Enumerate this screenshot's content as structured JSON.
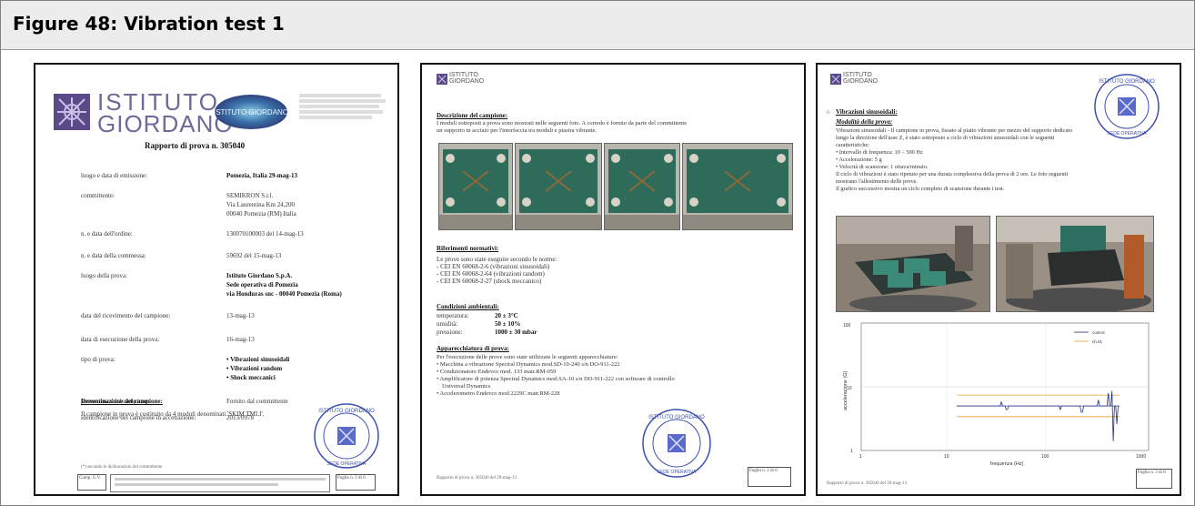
{
  "header": {
    "title": "Figure 48: Vibration test 1"
  },
  "page1": {
    "logo_line1": "ISTITUTO",
    "logo_line2": "GIORDANO",
    "badge_text": "ISTITUTO GIORDANO",
    "report_title": "Rapporto di prova n.  305040",
    "rows": [
      {
        "label": "luogo e data di emissione:",
        "value": "Pomezia, Italia   29-mag-13"
      },
      {
        "label": "committente:",
        "value": "SEMIKRON S.r.l."
      },
      {
        "label": "",
        "value": "Via Laurentina Km 24,200"
      },
      {
        "label": "",
        "value": "00040 Pomezia (RM) Italia"
      },
      {
        "label": "n. e data dell'ordine:",
        "value": "130070100003 del 14-mag-13"
      },
      {
        "label": "n. e data della commessa:",
        "value": "59692 del 15-mag-13"
      },
      {
        "label": "luogo della prova:",
        "value": "Istituto Giordano S.p.A."
      },
      {
        "label": "",
        "value": "Sede operativa di Pomezia"
      },
      {
        "label": "",
        "value": "via Honduras snc - 00040 Pomezia (Roma)"
      },
      {
        "label": "data del ricevimento del campione:",
        "value": "13-mag-13"
      },
      {
        "label": "data di esecuzione della prova:",
        "value": "16-mag-13"
      },
      {
        "label": "tipo di prova:",
        "value": "• Vibrazioni sinusoidali"
      },
      {
        "label": "",
        "value": "• Vibrazioni random"
      },
      {
        "label": "",
        "value": "• Shock meccanici"
      },
      {
        "label": "provenienza del campione:",
        "value": "Fornito dal committente"
      },
      {
        "label": "identificazione del campione in accettazione:",
        "value": "2013/0978"
      }
    ],
    "denom_heading": "Denominazione del campione:",
    "denom_text": "Il campione in prova è costituito da 4 moduli denominati 'SKIM TMLI'.",
    "footnote": "(*) secondo le dichiarazioni del committente",
    "box_left": "Comp. G.V.",
    "box_right": "Foglio n. 1 di 6"
  },
  "page2": {
    "logo_line1": "ISTITUTO",
    "logo_line2": "GIORDANO",
    "h1": "Descrizione del campione:",
    "p1a": "I moduli sottoposti a prova sono mostrati nelle seguenti foto. A corredo è fornito da parte del committente",
    "p1b": "un supporto in acciaio per l'interfaccia tra moduli e piastra vibrante.",
    "h2": "Riferimenti normativi:",
    "n0": "Le prove sono state eseguite secondo le norme:",
    "n1": "- CEI EN 60068-2-6 (vibrazioni sinusoidali)",
    "n2": "- CEI EN 60068-2-64 (vibrazioni random)",
    "n3": "- CEI EN 60068-2-27 (shock meccanico)",
    "h3": "Condizioni ambientali:",
    "c1l": "temperatura:",
    "c1v": "20 ± 3°C",
    "c2l": "umidità:",
    "c2v": "50 ± 10%",
    "c3l": "pressione:",
    "c3v": "1000 ± 30 mbar",
    "h4": "Apparecchiatura di prova:",
    "a0": "Per l'esecuzione delle prove sono state utilizzate le seguenti apparecchiature:",
    "a1": "• Macchina a vibrazione Spectral Dynamics mod.SD-10-240 s/n DO-911-222",
    "a2": "• Condizionatore Endevco mod. 133 matr.RM-059",
    "a3": "• Amplificatore di potenza Spectral Dynamics mod.SA-10 s/n DO-911-222 con software di controllo",
    "a3b": "Universal Dynamics",
    "a4": "• Accelerometro Endevco mod.2229C matr.RM-228",
    "footer": "Rapporto di prova n. 305040  del  29-mag-13",
    "box": "Foglio n. 2 di 6"
  },
  "page3": {
    "logo_line1": "ISTITUTO",
    "logo_line2": "GIORDANO",
    "h1": "Vibrazioni sinusoidali:",
    "h2": "Modalità della prova:",
    "l1": "Vibrazioni sinusoidali - Il campione in prova, fissato al piatto vibrante per mezzo del supporto dedicato",
    "l2": "lungo la direzione dell'asse Z, è stato sottoposto a ciclo di vibrazioni sinusoidali con le seguenti",
    "l3": "caratteristiche:",
    "b1": "• Intervallo di frequenza: 10 ÷ 500 Hz",
    "b2": "• Accelerazione: 5 g",
    "b3": "• Velocità di scansione: 1 ottava/minuto.",
    "l4": "Il ciclo di vibrazioni è stato ripetuto per una durata complessiva della prova di 2 ore. Le foto seguenti",
    "l5": "mostrano l'allestimento delle prove.",
    "l6": "Il grafico successivo mostra un ciclo completo di scansione durante i test.",
    "ylabel": "accelerazione (G)",
    "xlabel": "frequenza (Hz)",
    "legend1": "control",
    "legend2": "ch.01",
    "yt_top": "100",
    "yt_mid": "10",
    "yt_bot": "1",
    "xt1": "1",
    "xt2": "10",
    "xt3": "100",
    "xt4": "1000",
    "footer": "Rapporto di prova n. 305040  del  29-mag-13",
    "box": "Foglio n. 3 di 6"
  },
  "colors": {
    "header_bg": "#ececec",
    "stamp_blue": "#3b4fb0",
    "logo_purple": "#6a4c93",
    "plot_orange": "#e0a030",
    "plot_blue": "#203080"
  }
}
